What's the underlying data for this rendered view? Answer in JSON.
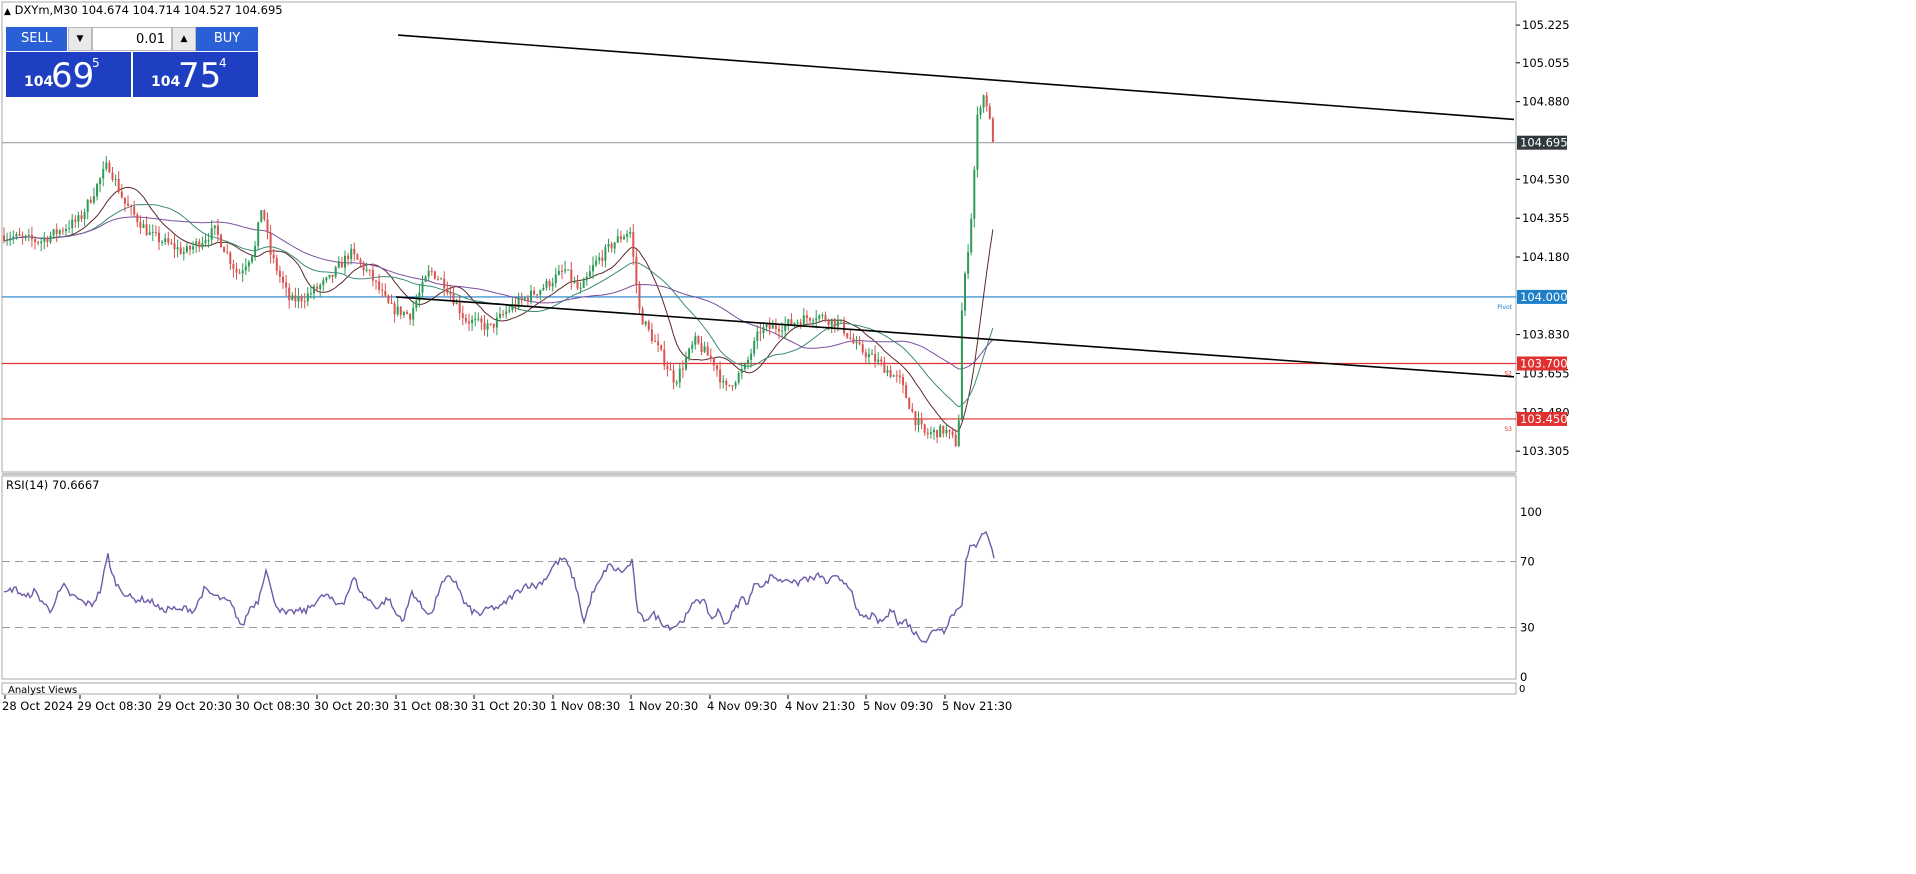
{
  "header": {
    "symbol_line": "DXYm,M30  104.674 104.714 104.527 104.695"
  },
  "trade_panel": {
    "sell_label": "SELL",
    "buy_label": "BUY",
    "lot_value": "0.01",
    "sell_quote": {
      "small": "104",
      "large": "69",
      "sup": "5"
    },
    "buy_quote": {
      "small": "104",
      "large": "75",
      "sup": "4"
    }
  },
  "levels": [
    {
      "name": "current-price",
      "value": 104.695,
      "label": "104.695",
      "text": "",
      "color": "#9aa0a6",
      "tag_bg": "#30393e"
    },
    {
      "name": "pivot",
      "value": 104.0,
      "label": "104.000",
      "text": "Pivot",
      "color": "#1e7fc9",
      "tag_bg": "#1e7fc9"
    },
    {
      "name": "s2",
      "value": 103.7,
      "label": "103.700",
      "text": "S2",
      "color": "#e03030",
      "tag_bg": "#e03030"
    },
    {
      "name": "s3",
      "value": 103.45,
      "label": "103.450",
      "text": "S3",
      "color": "#e03030",
      "tag_bg": "#e03030"
    }
  ],
  "rsi": {
    "label": "RSI(14) 70.6667",
    "ylim": [
      0,
      100
    ],
    "ticks": [
      "100",
      "70",
      "30",
      "0"
    ],
    "tick_values": [
      100,
      70,
      30,
      0
    ],
    "levels": [
      70,
      30
    ],
    "color": "#6f5aa8"
  },
  "footer": {
    "panel_label": "Analyst Views",
    "scale_label": "0"
  },
  "chart_data": {
    "type": "candlestick",
    "title": "DXYm,M30",
    "ylim": [
      103.22,
      105.32
    ],
    "y_ticks": [
      "105.225",
      "105.055",
      "104.880",
      "104.530",
      "104.355",
      "104.180",
      "103.830",
      "103.655",
      "103.480",
      "103.305"
    ],
    "y_tick_values": [
      105.225,
      105.055,
      104.88,
      104.53,
      104.355,
      104.18,
      103.83,
      103.655,
      103.48,
      103.305
    ],
    "x_ticks": [
      "28 Oct 2024",
      "29 Oct 08:30",
      "29 Oct 20:30",
      "30 Oct 08:30",
      "30 Oct 20:30",
      "31 Oct 08:30",
      "31 Oct 20:30",
      "1 Nov 08:30",
      "1 Nov 20:30",
      "4 Nov 09:30",
      "4 Nov 21:30",
      "5 Nov 09:30",
      "5 Nov 21:30"
    ],
    "up_color": "#2e9b57",
    "down_color": "#d9534f",
    "ma_colors": [
      "#5b2a2a",
      "#3c8a76",
      "#7a4f9e"
    ],
    "trendline_color": "#000000",
    "trendlines": [
      {
        "from": {
          "x": "29 Oct 20:30",
          "y": 105.18
        },
        "to": {
          "x": "6 Nov 12:30",
          "y": 104.8
        }
      },
      {
        "from": {
          "x": "31 Oct 08:30",
          "y": 104.0
        },
        "to": {
          "x": "6 Nov 12:30",
          "y": 103.64
        }
      }
    ],
    "rsi_anchor_points": [
      [
        0,
        50
      ],
      [
        10,
        54
      ],
      [
        22,
        48
      ],
      [
        30,
        52
      ],
      [
        38,
        46
      ],
      [
        46,
        40
      ],
      [
        54,
        50
      ],
      [
        60,
        55
      ],
      [
        66,
        50
      ],
      [
        72,
        48
      ],
      [
        80,
        45
      ],
      [
        88,
        44
      ],
      [
        96,
        52
      ],
      [
        104,
        74
      ],
      [
        108,
        62
      ],
      [
        114,
        55
      ],
      [
        122,
        50
      ],
      [
        130,
        47
      ],
      [
        140,
        47
      ],
      [
        150,
        45
      ],
      [
        158,
        40
      ],
      [
        166,
        42
      ],
      [
        174,
        40
      ],
      [
        182,
        42
      ],
      [
        190,
        40
      ],
      [
        200,
        53
      ],
      [
        208,
        50
      ],
      [
        218,
        47
      ],
      [
        226,
        45
      ],
      [
        232,
        38
      ],
      [
        238,
        30
      ],
      [
        246,
        42
      ],
      [
        254,
        46
      ],
      [
        262,
        66
      ],
      [
        268,
        50
      ],
      [
        274,
        42
      ],
      [
        282,
        38
      ],
      [
        292,
        40
      ],
      [
        302,
        40
      ],
      [
        312,
        46
      ],
      [
        322,
        50
      ],
      [
        332,
        44
      ],
      [
        340,
        46
      ],
      [
        350,
        60
      ],
      [
        358,
        50
      ],
      [
        366,
        46
      ],
      [
        374,
        42
      ],
      [
        384,
        48
      ],
      [
        392,
        38
      ],
      [
        400,
        35
      ],
      [
        408,
        52
      ],
      [
        418,
        42
      ],
      [
        428,
        38
      ],
      [
        436,
        55
      ],
      [
        444,
        60
      ],
      [
        452,
        58
      ],
      [
        460,
        45
      ],
      [
        468,
        40
      ],
      [
        476,
        38
      ],
      [
        486,
        42
      ],
      [
        496,
        42
      ],
      [
        506,
        48
      ],
      [
        514,
        52
      ],
      [
        522,
        56
      ],
      [
        532,
        55
      ],
      [
        542,
        60
      ],
      [
        550,
        68
      ],
      [
        560,
        72
      ],
      [
        566,
        65
      ],
      [
        572,
        55
      ],
      [
        580,
        33
      ],
      [
        588,
        50
      ],
      [
        596,
        58
      ],
      [
        604,
        68
      ],
      [
        612,
        65
      ],
      [
        620,
        64
      ],
      [
        628,
        70
      ],
      [
        634,
        38
      ],
      [
        640,
        35
      ],
      [
        650,
        38
      ],
      [
        660,
        32
      ],
      [
        668,
        30
      ],
      [
        676,
        33
      ],
      [
        684,
        38
      ],
      [
        692,
        48
      ],
      [
        700,
        45
      ],
      [
        708,
        35
      ],
      [
        714,
        40
      ],
      [
        722,
        32
      ],
      [
        730,
        40
      ],
      [
        738,
        48
      ],
      [
        744,
        45
      ],
      [
        752,
        58
      ],
      [
        760,
        55
      ],
      [
        768,
        62
      ],
      [
        776,
        58
      ],
      [
        784,
        60
      ],
      [
        792,
        56
      ],
      [
        800,
        60
      ],
      [
        808,
        59
      ],
      [
        816,
        62
      ],
      [
        822,
        57
      ],
      [
        830,
        60
      ],
      [
        838,
        59
      ],
      [
        846,
        55
      ],
      [
        852,
        40
      ],
      [
        860,
        36
      ],
      [
        868,
        37
      ],
      [
        876,
        33
      ],
      [
        882,
        36
      ],
      [
        890,
        42
      ],
      [
        894,
        32
      ],
      [
        902,
        34
      ],
      [
        910,
        27
      ],
      [
        916,
        24
      ],
      [
        922,
        22
      ],
      [
        928,
        27
      ],
      [
        934,
        30
      ],
      [
        940,
        28
      ],
      [
        946,
        36
      ],
      [
        952,
        40
      ],
      [
        958,
        45
      ],
      [
        962,
        70
      ],
      [
        966,
        78
      ],
      [
        972,
        80
      ],
      [
        978,
        88
      ],
      [
        984,
        86
      ],
      [
        990,
        72
      ]
    ]
  }
}
